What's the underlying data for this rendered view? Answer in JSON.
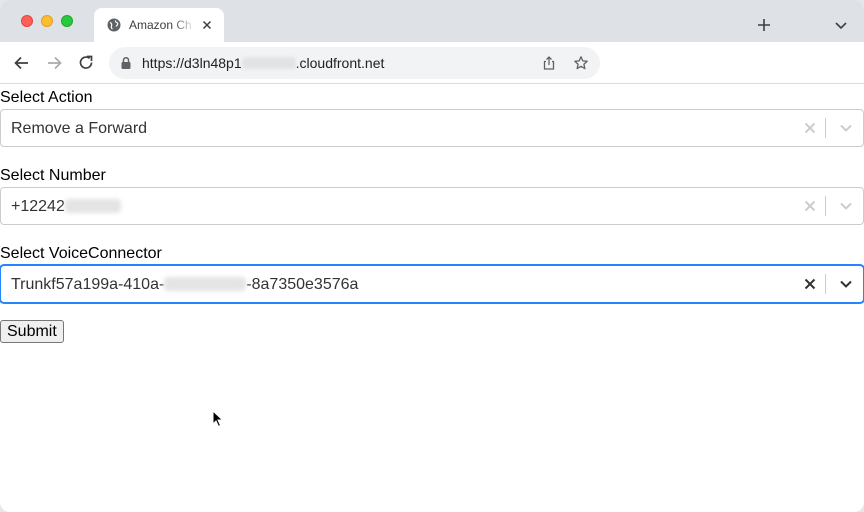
{
  "browser": {
    "tab": {
      "title": "Amazon Ch",
      "icon": "globe-icon",
      "close_icon": "close-icon"
    },
    "new_tab_icon": "plus-icon",
    "tab_search_icon": "chevron-down-icon",
    "nav": {
      "back_icon": "back-arrow-icon",
      "forward_icon": "forward-arrow-icon",
      "reload_icon": "reload-icon"
    },
    "address": {
      "prefix": "https://d3ln48p1",
      "suffix": ".cloudfront.net",
      "lock_icon": "lock-icon"
    },
    "share_icon": "share-icon",
    "bookmark_icon": "star-icon"
  },
  "form": {
    "action": {
      "label": "Select Action",
      "value": "Remove a Forward"
    },
    "number": {
      "label": "Select Number",
      "value": "+12242"
    },
    "voice_connector": {
      "label": "Select VoiceConnector",
      "value_prefix": "Trunkf57a199a-410a-",
      "value_suffix": "-8a7350e3576a"
    },
    "submit_label": "Submit"
  },
  "colors": {
    "focus_border": "#2684ff",
    "select_border": "#cccccc",
    "tabstrip_bg": "#dee1e6",
    "omnibox_bg": "#f1f3f4"
  }
}
